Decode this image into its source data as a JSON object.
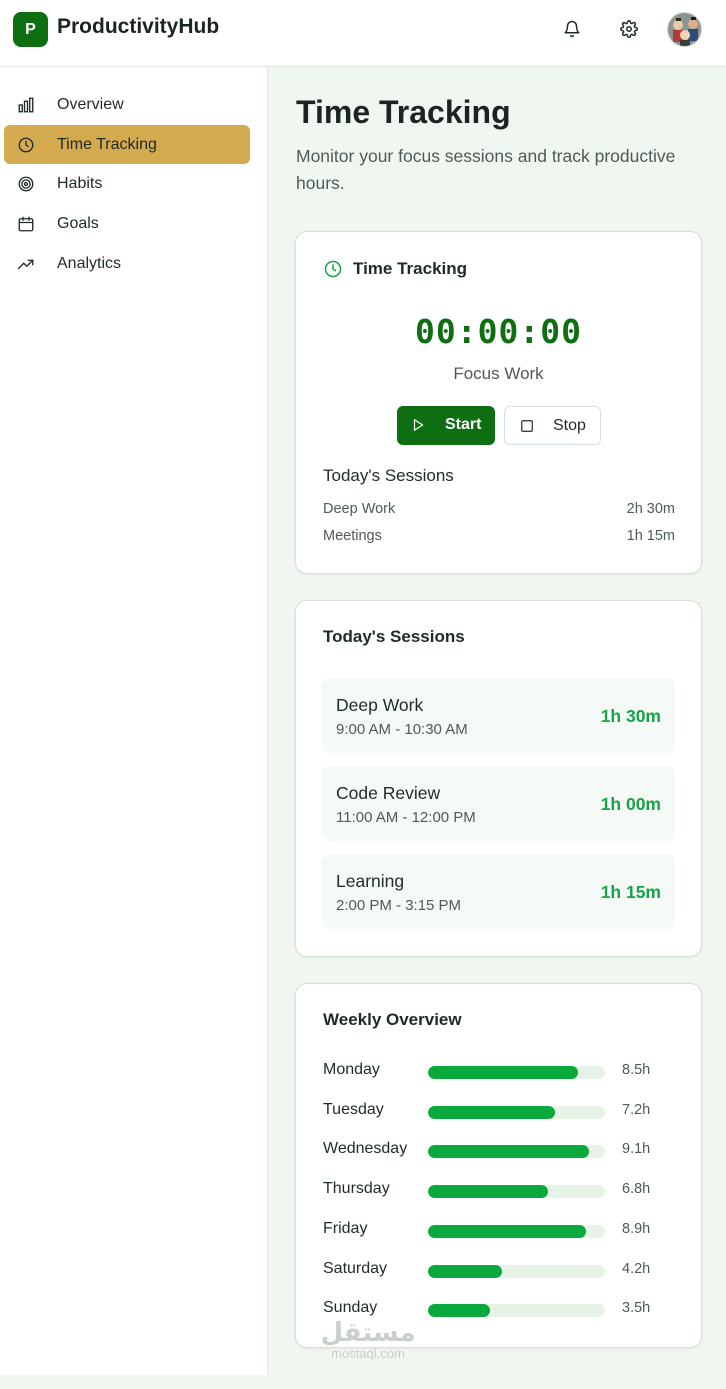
{
  "header": {
    "logo_letter": "P",
    "app_name": "ProductivityHub",
    "icons": [
      "bell-icon",
      "gear-icon"
    ]
  },
  "sidebar": {
    "items": [
      {
        "label": "Overview",
        "icon": "bar-chart-icon"
      },
      {
        "label": "Time Tracking",
        "icon": "clock-icon",
        "active": true
      },
      {
        "label": "Habits",
        "icon": "target-icon"
      },
      {
        "label": "Goals",
        "icon": "calendar-icon"
      },
      {
        "label": "Analytics",
        "icon": "trending-up-icon"
      }
    ],
    "active_color": "#d4aa4e"
  },
  "main": {
    "title": "Time Tracking",
    "subtitle": "Monitor your focus sessions and track productive hours."
  },
  "timer_card": {
    "title": "Time Tracking",
    "timer": "00:00:00",
    "activity": "Focus Work",
    "start_label": "Start",
    "stop_label": "Stop",
    "sessions_title": "Today's Sessions",
    "sessions": [
      {
        "name": "Deep Work",
        "duration": "2h 30m"
      },
      {
        "name": "Meetings",
        "duration": "1h 15m"
      }
    ]
  },
  "sessions_card": {
    "title": "Today's Sessions",
    "items": [
      {
        "name": "Deep Work",
        "time": "9:00 AM - 10:30 AM",
        "duration": "1h 30m"
      },
      {
        "name": "Code Review",
        "time": "11:00 AM - 12:00 PM",
        "duration": "1h 00m"
      },
      {
        "name": "Learning",
        "time": "2:00 PM - 3:15 PM",
        "duration": "1h 15m"
      }
    ]
  },
  "weekly_card": {
    "title": "Weekly Overview",
    "max_hours": 10,
    "days": [
      {
        "day": "Monday",
        "hours": 8.5,
        "label": "8.5h"
      },
      {
        "day": "Tuesday",
        "hours": 7.2,
        "label": "7.2h"
      },
      {
        "day": "Wednesday",
        "hours": 9.1,
        "label": "9.1h"
      },
      {
        "day": "Thursday",
        "hours": 6.8,
        "label": "6.8h"
      },
      {
        "day": "Friday",
        "hours": 8.9,
        "label": "8.9h"
      },
      {
        "day": "Saturday",
        "hours": 4.2,
        "label": "4.2h"
      },
      {
        "day": "Sunday",
        "hours": 3.5,
        "label": "3.5h"
      }
    ]
  },
  "watermark": {
    "arabic": "مستقل",
    "latin": "mostaql.com"
  },
  "colors": {
    "brand": "#0d6e12",
    "accent": "#16a34a",
    "bar": "#0aa93c"
  }
}
